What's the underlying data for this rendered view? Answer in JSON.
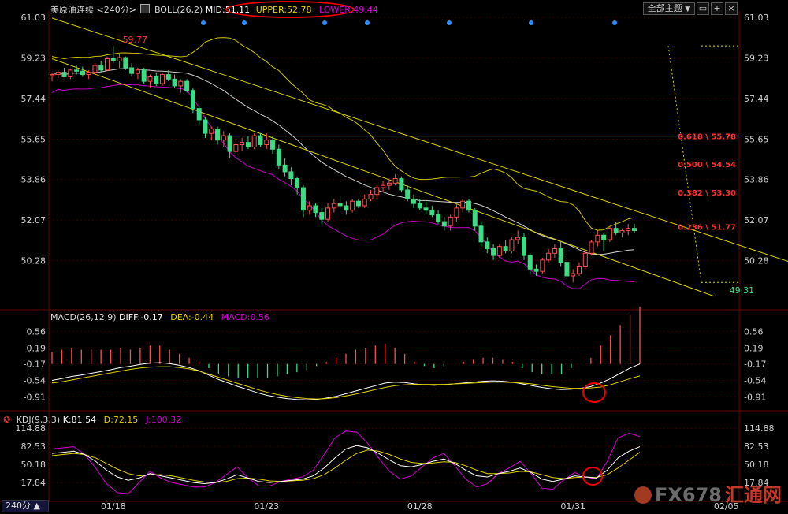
{
  "colors": {
    "bg": "#000000",
    "up": "#ff4d4d",
    "down": "#3ddc84",
    "grid": "#3a0000",
    "axis_text": "#cfcfcf",
    "boll_upper": "#c9c200",
    "boll_mid": "#d0d0d0",
    "boll_lower": "#c000c0",
    "channel": "#d8d000",
    "fib_line": "#7ac000",
    "fib_text": "#ff3030",
    "macd_diff": "#ffffff",
    "macd_dea": "#e0d000",
    "kdj_k": "#ffffff",
    "kdj_d": "#e0d000",
    "kdj_j": "#d000d0",
    "dot": "#2a8cff"
  },
  "header": {
    "symbol": "美原油连续",
    "period": "<240分>",
    "indicator": "BOLL(26,2)",
    "mid_label": "MID:51.11",
    "upper_label": "UPPER:52.78",
    "lower_label": "LOWER:49.44",
    "theme_button": "全部主题",
    "icon_buttons": [
      "dropdown-icon",
      "window-icon",
      "plus-icon",
      "close-icon"
    ]
  },
  "macd_header": {
    "title": "MACD(26,12,9)",
    "diff": "DIFF:-0.17",
    "dea": "DEA:-0.44",
    "macd": "MACD:0.56"
  },
  "kdj_header": {
    "title": "KDJ(9,3,3)",
    "k": "K:81.54",
    "d": "D:72.15",
    "j": "J:100.32"
  },
  "timeframe_button": "240分 ▲",
  "logo": {
    "fx": "FX678",
    "cn": "汇通网"
  },
  "chart_data": [
    {
      "type": "candlestick",
      "title": "美原油连续 240分",
      "price_ticks": [
        "61.03",
        "59.23",
        "57.44",
        "55.65",
        "53.86",
        "52.07",
        "50.28"
      ],
      "ylim": [
        48.9,
        61.03
      ],
      "x_labels": [
        {
          "label": "01/18",
          "at_bar": 10
        },
        {
          "label": "01/23",
          "at_bar": 35
        },
        {
          "label": "01/28",
          "at_bar": 60
        },
        {
          "label": "01/31",
          "at_bar": 85
        },
        {
          "label": "02/05",
          "at_bar": 110
        }
      ],
      "annotations": [
        {
          "text": "59.77",
          "price": 59.77,
          "bar": 11
        },
        {
          "text": "49.31",
          "price": 49.31,
          "bar": 110
        }
      ],
      "fib_levels": [
        {
          "text": "0.618 \\ 55.78",
          "value": 55.78
        },
        {
          "text": "0.500 \\ 54.54",
          "value": 54.54
        },
        {
          "text": "0.382 \\ 53.30",
          "value": 53.3
        },
        {
          "text": "0.236 \\ 51.77",
          "value": 51.77
        }
      ],
      "fib_range": {
        "high": 59.77,
        "low": 49.31
      },
      "channel": {
        "upper": [
          [
            0,
            61.0
          ],
          [
            125,
            49.8
          ]
        ],
        "lower": [
          [
            0,
            59.2
          ],
          [
            108,
            48.7
          ]
        ]
      },
      "ohlc": [
        [
          58.45,
          58.6,
          58.2,
          58.5
        ],
        [
          58.5,
          58.7,
          58.35,
          58.6
        ],
        [
          58.6,
          58.8,
          58.45,
          58.4
        ],
        [
          58.4,
          58.75,
          58.3,
          58.7
        ],
        [
          58.7,
          58.9,
          58.5,
          58.65
        ],
        [
          58.65,
          58.85,
          58.4,
          58.5
        ],
        [
          58.5,
          58.7,
          58.3,
          58.6
        ],
        [
          58.6,
          59.0,
          58.5,
          58.9
        ],
        [
          58.9,
          59.1,
          58.6,
          58.7
        ],
        [
          58.7,
          59.3,
          58.65,
          59.2
        ],
        [
          59.2,
          59.77,
          59.0,
          59.1
        ],
        [
          59.1,
          59.4,
          58.8,
          59.25
        ],
        [
          59.25,
          59.3,
          58.7,
          58.8
        ],
        [
          58.8,
          59.0,
          58.4,
          58.55
        ],
        [
          58.55,
          58.8,
          58.3,
          58.7
        ],
        [
          58.7,
          58.8,
          58.1,
          58.2
        ],
        [
          58.2,
          58.5,
          57.9,
          58.4
        ],
        [
          58.4,
          58.6,
          58.0,
          58.1
        ],
        [
          58.1,
          58.6,
          58.0,
          58.5
        ],
        [
          58.5,
          58.7,
          58.2,
          58.3
        ],
        [
          58.3,
          58.5,
          57.9,
          58.0
        ],
        [
          58.0,
          58.3,
          57.7,
          58.2
        ],
        [
          58.2,
          58.3,
          57.7,
          57.8
        ],
        [
          57.8,
          57.9,
          56.8,
          57.0
        ],
        [
          57.0,
          57.1,
          56.3,
          56.5
        ],
        [
          56.5,
          56.6,
          55.7,
          55.9
        ],
        [
          55.9,
          56.2,
          55.6,
          56.1
        ],
        [
          56.1,
          56.2,
          55.4,
          55.6
        ],
        [
          55.6,
          56.0,
          55.3,
          55.8
        ],
        [
          55.8,
          55.9,
          54.8,
          55.1
        ],
        [
          55.1,
          55.6,
          54.9,
          55.4
        ],
        [
          55.4,
          55.7,
          55.1,
          55.5
        ],
        [
          55.5,
          55.8,
          55.2,
          55.3
        ],
        [
          55.3,
          55.9,
          55.2,
          55.8
        ],
        [
          55.8,
          55.9,
          55.3,
          55.4
        ],
        [
          55.4,
          55.9,
          55.2,
          55.6
        ],
        [
          55.6,
          55.8,
          55.0,
          55.2
        ],
        [
          55.2,
          55.4,
          54.3,
          54.5
        ],
        [
          54.5,
          54.8,
          54.0,
          54.2
        ],
        [
          54.2,
          54.4,
          53.6,
          53.9
        ],
        [
          53.9,
          54.0,
          53.2,
          53.5
        ],
        [
          53.5,
          53.6,
          52.2,
          52.5
        ],
        [
          52.5,
          52.9,
          52.3,
          52.7
        ],
        [
          52.7,
          52.8,
          52.2,
          52.4
        ],
        [
          52.4,
          52.6,
          51.9,
          52.1
        ],
        [
          52.1,
          52.8,
          52.0,
          52.6
        ],
        [
          52.6,
          53.0,
          52.4,
          52.8
        ],
        [
          52.8,
          53.1,
          52.6,
          52.7
        ],
        [
          52.7,
          52.9,
          52.3,
          52.5
        ],
        [
          52.5,
          53.0,
          52.4,
          52.9
        ],
        [
          52.9,
          53.0,
          52.6,
          52.7
        ],
        [
          52.7,
          53.2,
          52.6,
          53.0
        ],
        [
          53.0,
          53.4,
          52.9,
          53.2
        ],
        [
          53.2,
          53.6,
          53.0,
          53.5
        ],
        [
          53.5,
          53.8,
          53.3,
          53.6
        ],
        [
          53.6,
          53.9,
          53.4,
          53.7
        ],
        [
          53.7,
          54.1,
          53.6,
          53.9
        ],
        [
          53.9,
          54.0,
          53.3,
          53.4
        ],
        [
          53.4,
          53.6,
          52.9,
          53.0
        ],
        [
          53.0,
          53.2,
          52.6,
          52.8
        ],
        [
          52.8,
          53.0,
          52.5,
          52.6
        ],
        [
          52.6,
          52.9,
          52.3,
          52.5
        ],
        [
          52.5,
          52.7,
          52.2,
          52.3
        ],
        [
          52.3,
          52.5,
          51.9,
          52.0
        ],
        [
          52.0,
          52.2,
          51.6,
          51.8
        ],
        [
          51.8,
          52.3,
          51.6,
          52.2
        ],
        [
          52.2,
          52.8,
          52.0,
          52.6
        ],
        [
          52.6,
          53.0,
          52.4,
          52.9
        ],
        [
          52.9,
          53.0,
          52.4,
          52.5
        ],
        [
          52.5,
          52.6,
          51.6,
          51.8
        ],
        [
          51.8,
          52.0,
          50.9,
          51.1
        ],
        [
          51.1,
          51.3,
          50.6,
          50.8
        ],
        [
          50.8,
          51.0,
          50.3,
          50.5
        ],
        [
          50.5,
          51.0,
          50.4,
          50.9
        ],
        [
          50.9,
          51.2,
          50.6,
          50.7
        ],
        [
          50.7,
          51.3,
          50.6,
          51.2
        ],
        [
          51.2,
          51.6,
          51.0,
          51.3
        ],
        [
          51.3,
          51.5,
          50.3,
          50.5
        ],
        [
          50.5,
          50.6,
          49.7,
          49.9
        ],
        [
          49.9,
          50.1,
          49.6,
          49.8
        ],
        [
          49.8,
          50.4,
          49.7,
          50.3
        ],
        [
          50.3,
          50.8,
          50.2,
          50.6
        ],
        [
          50.6,
          51.0,
          50.4,
          50.8
        ],
        [
          50.8,
          51.1,
          50.0,
          50.2
        ],
        [
          50.2,
          50.4,
          49.5,
          49.6
        ],
        [
          49.6,
          49.9,
          49.31,
          49.7
        ],
        [
          49.7,
          50.2,
          49.6,
          50.0
        ],
        [
          50.0,
          50.7,
          49.9,
          50.6
        ],
        [
          50.6,
          51.2,
          50.5,
          51.1
        ],
        [
          51.1,
          51.6,
          50.9,
          51.4
        ],
        [
          51.4,
          51.5,
          50.7,
          51.2
        ],
        [
          51.2,
          51.8,
          51.1,
          51.7
        ],
        [
          51.7,
          52.0,
          51.4,
          51.5
        ],
        [
          51.5,
          51.7,
          51.3,
          51.6
        ],
        [
          51.6,
          51.9,
          51.4,
          51.7
        ],
        [
          51.7,
          51.9,
          51.5,
          51.6
        ]
      ]
    },
    {
      "type": "line",
      "title": "MACD(26,12,9)",
      "ticks": [
        "0.56",
        "0.19",
        "-0.17",
        "-0.54",
        "-0.91"
      ],
      "ylim": [
        -1.1,
        0.75
      ],
      "series": [
        {
          "name": "DIFF",
          "values": [
            -0.54,
            -0.5,
            -0.45,
            -0.42,
            -0.38,
            -0.34,
            -0.3,
            -0.25,
            -0.22,
            -0.18,
            -0.15,
            -0.14,
            -0.16,
            -0.2,
            -0.25,
            -0.32,
            -0.42,
            -0.52,
            -0.6,
            -0.68,
            -0.75,
            -0.82,
            -0.88,
            -0.92,
            -0.95,
            -0.97,
            -0.98,
            -0.97,
            -0.94,
            -0.9,
            -0.84,
            -0.78,
            -0.72,
            -0.66,
            -0.6,
            -0.58,
            -0.59,
            -0.62,
            -0.64,
            -0.65,
            -0.64,
            -0.62,
            -0.6,
            -0.58,
            -0.56,
            -0.55,
            -0.56,
            -0.58,
            -0.62,
            -0.66,
            -0.7,
            -0.73,
            -0.75,
            -0.74,
            -0.72,
            -0.68,
            -0.6,
            -0.5,
            -0.38,
            -0.26,
            -0.17
          ]
        },
        {
          "name": "DEA",
          "values": [
            -0.6,
            -0.57,
            -0.53,
            -0.49,
            -0.45,
            -0.41,
            -0.37,
            -0.33,
            -0.29,
            -0.26,
            -0.24,
            -0.23,
            -0.23,
            -0.25,
            -0.28,
            -0.33,
            -0.4,
            -0.47,
            -0.54,
            -0.61,
            -0.68,
            -0.75,
            -0.81,
            -0.86,
            -0.9,
            -0.93,
            -0.95,
            -0.96,
            -0.95,
            -0.93,
            -0.89,
            -0.85,
            -0.8,
            -0.75,
            -0.7,
            -0.66,
            -0.64,
            -0.63,
            -0.63,
            -0.63,
            -0.63,
            -0.62,
            -0.61,
            -0.6,
            -0.59,
            -0.58,
            -0.58,
            -0.59,
            -0.6,
            -0.62,
            -0.65,
            -0.68,
            -0.7,
            -0.72,
            -0.72,
            -0.71,
            -0.69,
            -0.64,
            -0.57,
            -0.5,
            -0.44
          ]
        },
        {
          "name": "MACD",
          "values": [
            0.12,
            0.14,
            0.16,
            0.14,
            0.14,
            0.14,
            0.14,
            0.16,
            0.14,
            0.16,
            0.18,
            0.18,
            0.14,
            0.1,
            0.06,
            0.02,
            -0.04,
            -0.1,
            -0.12,
            -0.14,
            -0.14,
            -0.14,
            -0.14,
            -0.12,
            -0.1,
            -0.08,
            -0.06,
            -0.02,
            0.02,
            0.06,
            0.1,
            0.14,
            0.16,
            0.18,
            0.2,
            0.16,
            0.1,
            0.02,
            -0.02,
            -0.04,
            -0.02,
            0.0,
            0.02,
            0.04,
            0.06,
            0.06,
            0.04,
            0.02,
            -0.04,
            -0.08,
            -0.1,
            -0.1,
            -0.1,
            -0.04,
            0.0,
            0.06,
            0.18,
            0.28,
            0.38,
            0.48,
            0.56
          ]
        }
      ]
    },
    {
      "type": "line",
      "title": "KDJ(9,3,3)",
      "ticks": [
        "114.88",
        "82.53",
        "50.18",
        "17.84"
      ],
      "ylim": [
        -10,
        125
      ],
      "series": [
        {
          "name": "K",
          "values": [
            70,
            72,
            74,
            68,
            56,
            40,
            28,
            22,
            26,
            34,
            30,
            26,
            22,
            18,
            16,
            18,
            24,
            32,
            26,
            20,
            18,
            20,
            22,
            24,
            30,
            44,
            62,
            78,
            84,
            80,
            70,
            58,
            48,
            46,
            50,
            56,
            60,
            52,
            40,
            30,
            28,
            34,
            38,
            44,
            36,
            24,
            20,
            24,
            30,
            28,
            26,
            40,
            62,
            74,
            82
          ]
        },
        {
          "name": "D",
          "values": [
            66,
            68,
            70,
            68,
            62,
            52,
            42,
            34,
            30,
            32,
            32,
            30,
            26,
            22,
            19,
            18,
            20,
            25,
            26,
            24,
            21,
            20,
            21,
            22,
            25,
            32,
            44,
            58,
            70,
            76,
            74,
            68,
            60,
            54,
            52,
            53,
            55,
            54,
            48,
            40,
            34,
            34,
            35,
            38,
            37,
            32,
            27,
            25,
            27,
            28,
            27,
            32,
            44,
            58,
            72
          ]
        },
        {
          "name": "J",
          "values": [
            78,
            80,
            82,
            68,
            44,
            16,
            0,
            -2,
            18,
            38,
            26,
            18,
            14,
            10,
            10,
            18,
            32,
            46,
            26,
            12,
            12,
            20,
            24,
            28,
            40,
            68,
            98,
            110,
            108,
            88,
            62,
            38,
            24,
            30,
            46,
            62,
            70,
            48,
            24,
            10,
            16,
            34,
            44,
            56,
            34,
            8,
            6,
            22,
            36,
            28,
            24,
            56,
            98,
            106,
            100
          ]
        }
      ]
    }
  ]
}
